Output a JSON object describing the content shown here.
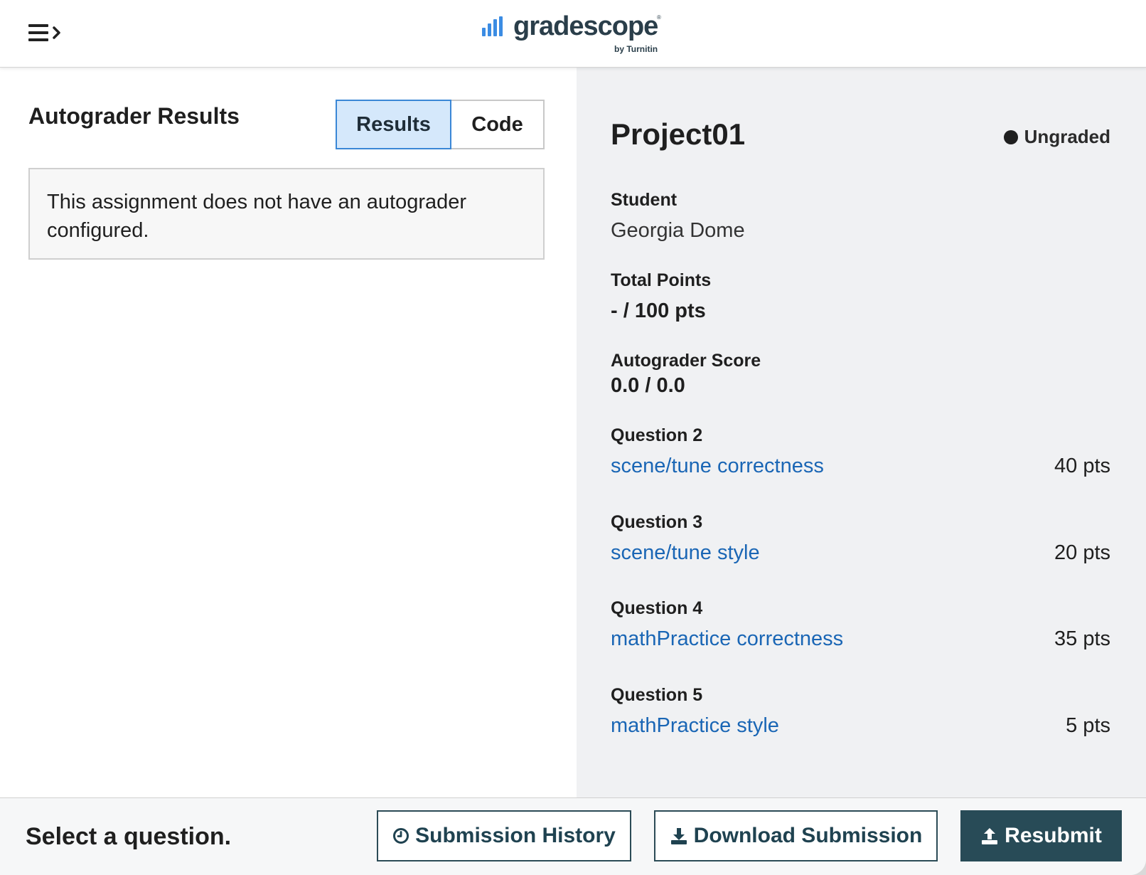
{
  "header": {
    "menu_icon": "menu-expand-icon",
    "logo_text": "gradescope",
    "logo_sub": "by Turnitin",
    "logo_color": "#2a3e4a",
    "logo_bar_color": "#3b8ce3"
  },
  "left_panel": {
    "title": "Autograder Results",
    "tabs": [
      {
        "label": "Results",
        "active": true
      },
      {
        "label": "Code",
        "active": false
      }
    ],
    "message": "This assignment does not have an autograder configured."
  },
  "right_panel": {
    "assignment_title": "Project01",
    "status": "Ungraded",
    "student_label": "Student",
    "student_name": "Georgia Dome",
    "total_points_label": "Total Points",
    "total_points_value": "- / 100 pts",
    "autograder_label": "Autograder Score",
    "autograder_value": "0.0 / 0.0",
    "questions": [
      {
        "label": "Question 2",
        "title": "scene/tune correctness",
        "points": "40 pts"
      },
      {
        "label": "Question 3",
        "title": "scene/tune style",
        "points": "20 pts"
      },
      {
        "label": "Question 4",
        "title": "mathPractice correctness",
        "points": "35 pts"
      },
      {
        "label": "Question 5",
        "title": "mathPractice style",
        "points": "5 pts"
      }
    ],
    "link_color": "#1a66b5"
  },
  "footer": {
    "prompt": "Select a question.",
    "buttons": {
      "history": {
        "label": "Submission History",
        "icon": "clock-icon"
      },
      "download": {
        "label": "Download Submission",
        "icon": "download-icon"
      },
      "resubmit": {
        "label": "Resubmit",
        "icon": "upload-icon"
      }
    },
    "primary_color": "#284b57"
  }
}
